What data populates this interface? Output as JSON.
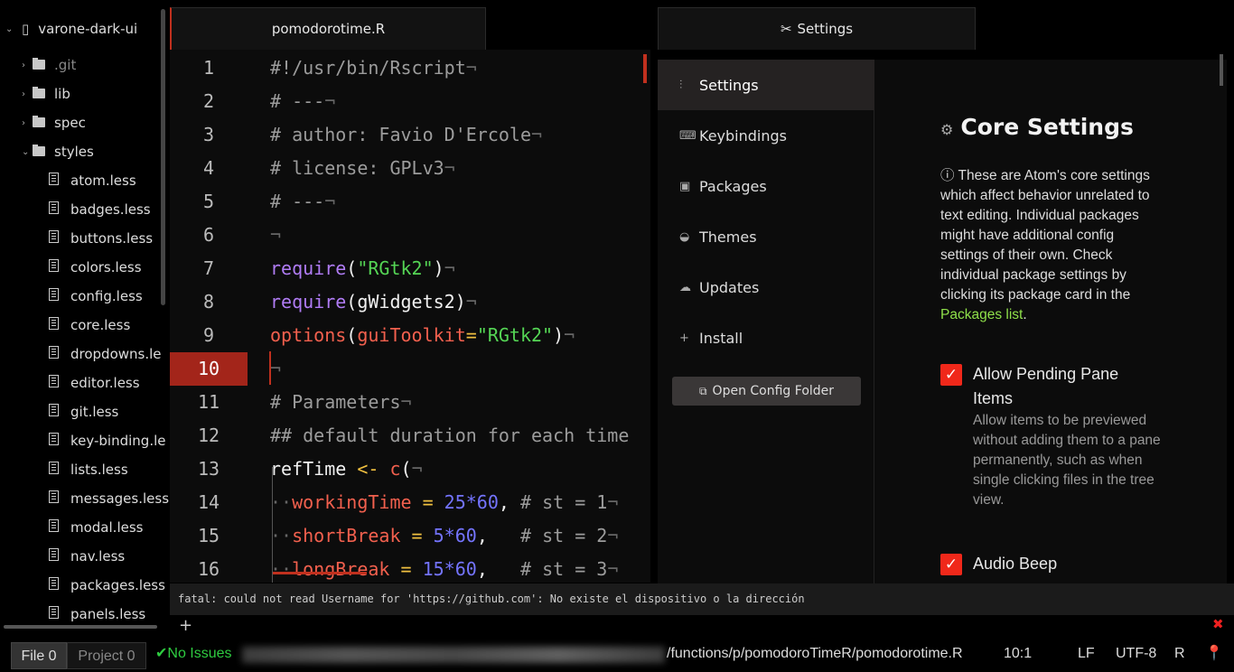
{
  "tree": {
    "root": "varone-dark-ui",
    "items": [
      {
        "name": ".git",
        "type": "folder",
        "depth": 1,
        "open": false,
        "dim": true
      },
      {
        "name": "lib",
        "type": "folder",
        "depth": 1,
        "open": false
      },
      {
        "name": "spec",
        "type": "folder",
        "depth": 1,
        "open": false
      },
      {
        "name": "styles",
        "type": "folder",
        "depth": 1,
        "open": true
      },
      {
        "name": "atom.less",
        "type": "file",
        "depth": 2
      },
      {
        "name": "badges.less",
        "type": "file",
        "depth": 2
      },
      {
        "name": "buttons.less",
        "type": "file",
        "depth": 2
      },
      {
        "name": "colors.less",
        "type": "file",
        "depth": 2
      },
      {
        "name": "config.less",
        "type": "file",
        "depth": 2
      },
      {
        "name": "core.less",
        "type": "file",
        "depth": 2
      },
      {
        "name": "dropdowns.le",
        "type": "file",
        "depth": 2
      },
      {
        "name": "editor.less",
        "type": "file",
        "depth": 2
      },
      {
        "name": "git.less",
        "type": "file",
        "depth": 2
      },
      {
        "name": "key-binding.le",
        "type": "file",
        "depth": 2
      },
      {
        "name": "lists.less",
        "type": "file",
        "depth": 2
      },
      {
        "name": "messages.less",
        "type": "file",
        "depth": 2
      },
      {
        "name": "modal.less",
        "type": "file",
        "depth": 2
      },
      {
        "name": "nav.less",
        "type": "file",
        "depth": 2
      },
      {
        "name": "packages.less",
        "type": "file",
        "depth": 2
      },
      {
        "name": "panels.less",
        "type": "file",
        "depth": 2
      }
    ]
  },
  "tabs": {
    "editor": "pomodorotime.R",
    "settings": "Settings"
  },
  "editor": {
    "current_line": 10,
    "lines": [
      [
        [
          "cm",
          "#!/usr/bin/Rscript"
        ],
        [
          "ws",
          "¬"
        ]
      ],
      [
        [
          "cm",
          "# ---"
        ],
        [
          "ws",
          "¬"
        ]
      ],
      [
        [
          "cm",
          "# author: Favio D'Ercole"
        ],
        [
          "ws",
          "¬"
        ]
      ],
      [
        [
          "cm",
          "# license: GPLv3"
        ],
        [
          "ws",
          "¬"
        ]
      ],
      [
        [
          "cm",
          "# ---"
        ],
        [
          "ws",
          "¬"
        ]
      ],
      [
        [
          "ws",
          "¬"
        ]
      ],
      [
        [
          "fn",
          "require"
        ],
        [
          "id",
          "("
        ],
        [
          "st",
          "\"RGtk2\""
        ],
        [
          "id",
          ")"
        ],
        [
          "ws",
          "¬"
        ]
      ],
      [
        [
          "fn",
          "require"
        ],
        [
          "id",
          "(gWidgets2)"
        ],
        [
          "ws",
          "¬"
        ]
      ],
      [
        [
          "nm",
          "options"
        ],
        [
          "id",
          "("
        ],
        [
          "nm",
          "guiToolkit"
        ],
        [
          "op",
          "="
        ],
        [
          "st",
          "\"RGtk2\""
        ],
        [
          "id",
          ")"
        ],
        [
          "ws",
          "¬"
        ]
      ],
      [
        [
          "ws",
          "¬"
        ]
      ],
      [
        [
          "cm",
          "# Parameters"
        ],
        [
          "ws",
          "¬"
        ]
      ],
      [
        [
          "cm",
          "## default duration for each time"
        ]
      ],
      [
        [
          "id",
          "refTime "
        ],
        [
          "op",
          "<-"
        ],
        [
          "id",
          " "
        ],
        [
          "nm",
          "c"
        ],
        [
          "id",
          "("
        ],
        [
          "ws",
          "¬"
        ]
      ],
      [
        [
          "ws",
          "··"
        ],
        [
          "nm",
          "workingTime"
        ],
        [
          "op",
          " = "
        ],
        [
          "nu",
          "25*60"
        ],
        [
          "id",
          ", "
        ],
        [
          "cm",
          "# st = 1"
        ],
        [
          "ws",
          "¬"
        ]
      ],
      [
        [
          "ws",
          "··"
        ],
        [
          "nm",
          "shortBreak"
        ],
        [
          "op",
          " = "
        ],
        [
          "nu",
          "5*60"
        ],
        [
          "id",
          ",   "
        ],
        [
          "cm",
          "# st = 2"
        ],
        [
          "ws",
          "¬"
        ]
      ],
      [
        [
          "ws",
          "··"
        ],
        [
          "nm",
          "longBreak"
        ],
        [
          "op",
          " = "
        ],
        [
          "nu",
          "15*60"
        ],
        [
          "id",
          ",   "
        ],
        [
          "cm",
          "# st = 3"
        ],
        [
          "ws",
          "¬"
        ]
      ]
    ]
  },
  "settings": {
    "nav": [
      {
        "label": "Settings",
        "icon": "sliders-icon",
        "active": true
      },
      {
        "label": "Keybindings",
        "icon": "keyboard-icon"
      },
      {
        "label": "Packages",
        "icon": "package-icon"
      },
      {
        "label": "Themes",
        "icon": "paintcan-icon"
      },
      {
        "label": "Updates",
        "icon": "cloud-download-icon"
      },
      {
        "label": "Install",
        "icon": "plus-icon"
      }
    ],
    "open_config": "Open Config Folder",
    "title": "Core Settings",
    "desc": "These are Atom's core settings which affect behavior unrelated to text editing. Individual packages might have additional config settings of their own. Check individual package settings by clicking its package card in the ",
    "desc_link": "Packages list",
    "desc_end": ".",
    "options": [
      {
        "title": "Allow Pending Pane Items",
        "desc": "Allow items to be previewed without adding them to a pane permanently, such as when single clicking files in the tree view.",
        "checked": true
      },
      {
        "title": "Audio Beep",
        "desc": "",
        "checked": true
      }
    ]
  },
  "console": {
    "message": "fatal: could not read Username for 'https://github.com': No existe el dispositivo o la dirección"
  },
  "status": {
    "file": "File 0",
    "project": "Project 0",
    "issues": "No Issues",
    "path": "/functions/p/pomodoroTimeR/pomodorotime.R",
    "cursor": "10:1",
    "eol": "LF",
    "encoding": "UTF-8",
    "grammar": "R"
  },
  "colors": {
    "accent": "#f0281a",
    "link": "#8fe04a",
    "ok": "#2ecc40"
  }
}
